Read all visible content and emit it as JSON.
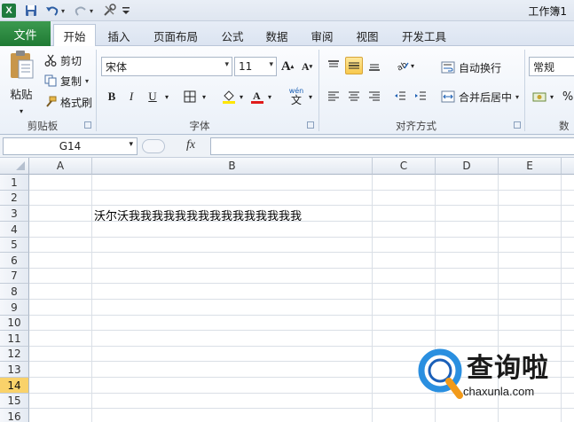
{
  "title_bar": {
    "app_logo": "X",
    "quick_access": [
      "save-icon",
      "undo-icon",
      "redo-icon",
      "tools-icon",
      "customize-icon"
    ],
    "title": "工作簿1"
  },
  "tabs": {
    "file": "文件",
    "items": [
      "开始",
      "插入",
      "页面布局",
      "公式",
      "数据",
      "审阅",
      "视图",
      "开发工具"
    ],
    "active": "开始"
  },
  "ribbon": {
    "clipboard": {
      "paste": "粘贴",
      "cut": "剪切",
      "copy": "复制",
      "format_painter": "格式刷",
      "label": "剪贴板"
    },
    "font": {
      "font_name": "宋体",
      "font_size": "11",
      "bold": "B",
      "italic": "I",
      "underline": "U",
      "label": "字体",
      "grow": "A",
      "shrink": "A",
      "wen": "wén"
    },
    "alignment": {
      "wrap_text": "自动换行",
      "merge_center": "合并后居中",
      "label": "对齐方式"
    },
    "number": {
      "format": "常规",
      "percent": "%",
      "label": "数"
    }
  },
  "formula_bar": {
    "name_box": "G14",
    "fx": "fx",
    "value": ""
  },
  "sheet": {
    "columns": [
      "A",
      "B",
      "C",
      "D",
      "E"
    ],
    "rows": [
      "1",
      "2",
      "3",
      "4",
      "5",
      "6",
      "7",
      "8",
      "9",
      "10",
      "11",
      "12",
      "13",
      "14",
      "15",
      "16"
    ],
    "active_row": "14",
    "cell_B3": "沃尔沃我我我我我我我我我我我我我我我"
  },
  "watermark": {
    "text": "查询啦",
    "url": "chaxunla.com"
  }
}
